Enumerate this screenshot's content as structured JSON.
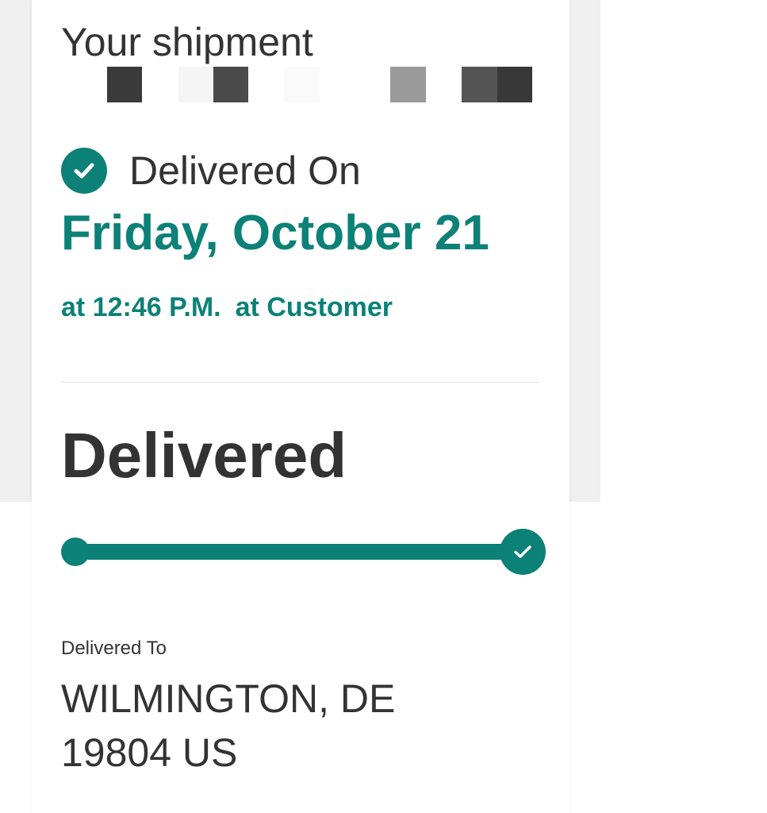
{
  "shipment": {
    "title": "Your shipment",
    "status_label": "Delivered On",
    "delivery_date": "Friday, October 21",
    "delivery_time": "at 12:46 P.M.",
    "delivery_location": "at Customer",
    "status_heading": "Delivered",
    "progress_percent": 100,
    "delivered_to_label": "Delivered To",
    "address_line1": "WILMINGTON, DE",
    "address_line2": "19804 US"
  },
  "colors": {
    "accent": "#0c8177",
    "text": "#333333",
    "background_panel": "#efefef",
    "card": "#ffffff"
  },
  "icons": {
    "status": "check-circle-icon",
    "progress_end": "check-icon"
  }
}
